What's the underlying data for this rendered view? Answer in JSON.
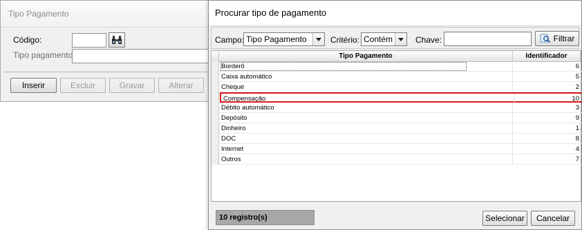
{
  "background_window": {
    "title": "Tipo Pagamento",
    "codigo_label": "Código:",
    "codigo_value": "",
    "tipo_label": "Tipo pagamento",
    "tipo_value": "",
    "buttons": [
      "Inserir",
      "Excluir",
      "Gravar",
      "Alterar"
    ]
  },
  "dialog": {
    "title": "Procurar tipo de pagamento",
    "campo_label": "Campo:",
    "campo_value": "Tipo Pagamento",
    "criterio_label": "Critério:",
    "criterio_value": "Contém",
    "chave_label": "Chave:",
    "chave_value": "",
    "filter_label": "Filtrar",
    "columns": [
      "Tipo Pagamento",
      "Identificador"
    ],
    "rows": [
      {
        "name": "Borderô",
        "id": "6"
      },
      {
        "name": "Caixa automático",
        "id": "5"
      },
      {
        "name": "Cheque",
        "id": "2"
      },
      {
        "name": "Compensação",
        "id": "10"
      },
      {
        "name": "Débito automático",
        "id": "3"
      },
      {
        "name": "Depósito",
        "id": "9"
      },
      {
        "name": "Dinheiro",
        "id": "1"
      },
      {
        "name": "DOC",
        "id": "8"
      },
      {
        "name": "Internet",
        "id": "4"
      },
      {
        "name": "Outros",
        "id": "7"
      }
    ],
    "status": "10 registro(s)",
    "select_label": "Selecionar",
    "cancel_label": "Cancelar"
  },
  "colors": {
    "selected_row_border": "#d9161c",
    "status_bg": "#a8a8a8"
  }
}
